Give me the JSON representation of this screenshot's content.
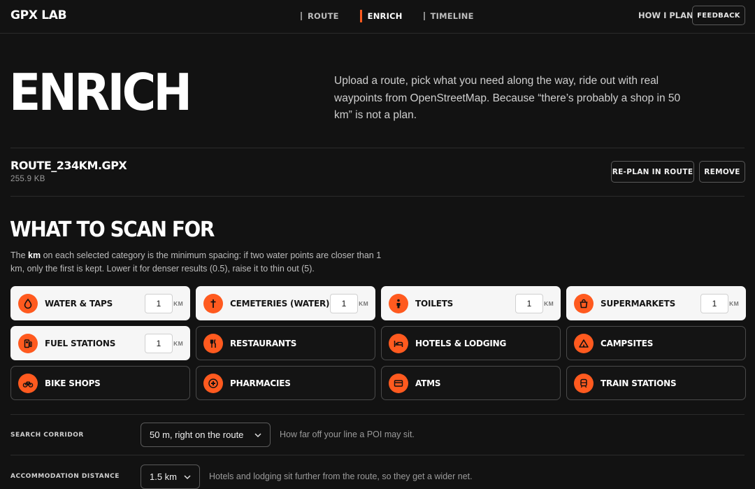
{
  "app": {
    "brand": "GPX LAB",
    "nav": [
      {
        "label": "ROUTE",
        "active": false
      },
      {
        "label": "ENRICH",
        "active": true
      },
      {
        "label": "TIMELINE",
        "active": false
      }
    ],
    "how_i_plan": "HOW I PLAN",
    "feedback": "FEEDBACK",
    "accent_color": "#ff5a1f"
  },
  "hero": {
    "title": "ENRICH",
    "description": "Upload a route, pick what you need along the way, ride out with real waypoints from OpenStreetMap. Because “there’s probably a shop in 50 km” is not a plan."
  },
  "file": {
    "name": "ROUTE_234KM.GPX",
    "size": "255.9 KB",
    "replan_label": "RE-PLAN IN ROUTE",
    "remove_label": "REMOVE"
  },
  "scan": {
    "title": "WHAT TO SCAN FOR",
    "desc_prefix": "The",
    "desc_bold": "km",
    "desc_suffix": "on each selected category is the minimum spacing: if two water points are closer than 1 km, only the first is kept. Lower it for denser results (0.5), raise it to thin out (5).",
    "km_unit": "KM",
    "categories": [
      {
        "label": "WATER & TAPS",
        "icon": "water-drop-icon",
        "selected": true,
        "km": "1"
      },
      {
        "label": "CEMETERIES (WATER)",
        "icon": "cross-icon",
        "selected": true,
        "km": "1"
      },
      {
        "label": "TOILETS",
        "icon": "person-icon",
        "selected": true,
        "km": "1"
      },
      {
        "label": "SUPERMARKETS",
        "icon": "basket-icon",
        "selected": true,
        "km": "1"
      },
      {
        "label": "FUEL STATIONS",
        "icon": "fuel-pump-icon",
        "selected": true,
        "km": "1"
      },
      {
        "label": "RESTAURANTS",
        "icon": "cutlery-icon",
        "selected": false
      },
      {
        "label": "HOTELS & LODGING",
        "icon": "bed-icon",
        "selected": false
      },
      {
        "label": "CAMPSITES",
        "icon": "tent-icon",
        "selected": false
      },
      {
        "label": "BIKE SHOPS",
        "icon": "bicycle-icon",
        "selected": false
      },
      {
        "label": "PHARMACIES",
        "icon": "medical-cross-icon",
        "selected": false
      },
      {
        "label": "ATMS",
        "icon": "card-icon",
        "selected": false
      },
      {
        "label": "TRAIN STATIONS",
        "icon": "train-icon",
        "selected": false
      }
    ]
  },
  "settings": {
    "corridor": {
      "label": "SEARCH CORRIDOR",
      "value": "50 m, right on the route",
      "hint": "How far off your line a POI may sit."
    },
    "accommodation": {
      "label": "ACCOMMODATION DISTANCE",
      "value": "1.5 km",
      "hint": "Hotels and lodging sit further from the route, so they get a wider net."
    }
  }
}
